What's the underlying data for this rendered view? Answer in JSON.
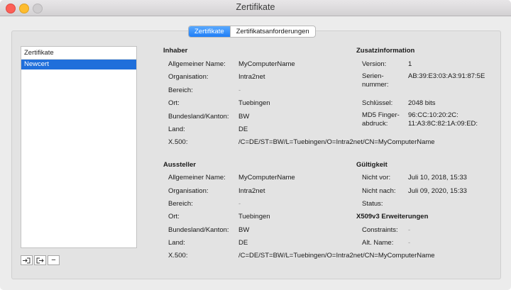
{
  "window": {
    "title": "Zertifikate"
  },
  "tabs": [
    {
      "label": "Zertifikate",
      "active": true
    },
    {
      "label": "Zertifikatsanforderungen",
      "active": false
    }
  ],
  "list": {
    "header": "Zertifikate",
    "items": [
      "Newcert"
    ]
  },
  "inhaber": {
    "heading": "Inhaber",
    "rows": [
      {
        "label": "Allgemeiner Name:",
        "value": "MyComputerName"
      },
      {
        "label": "Organisation:",
        "value": "Intra2net"
      },
      {
        "label": "Bereich:",
        "value": "-"
      },
      {
        "label": "Ort:",
        "value": "Tuebingen"
      },
      {
        "label": "Bundesland/Kanton:",
        "value": "BW"
      },
      {
        "label": "Land:",
        "value": "DE"
      },
      {
        "label": "X.500:",
        "value": "/C=DE/ST=BW/L=Tuebingen/O=Intra2net/CN=MyComputerName"
      }
    ]
  },
  "aussteller": {
    "heading": "Aussteller",
    "rows": [
      {
        "label": "Allgemeiner Name:",
        "value": "MyComputerName"
      },
      {
        "label": "Organisation:",
        "value": "Intra2net"
      },
      {
        "label": "Bereich:",
        "value": "-"
      },
      {
        "label": "Ort:",
        "value": "Tuebingen"
      },
      {
        "label": "Bundesland/Kanton:",
        "value": "BW"
      },
      {
        "label": "Land:",
        "value": "DE"
      },
      {
        "label": "X.500:",
        "value": "/C=DE/ST=BW/L=Tuebingen/O=Intra2net/CN=MyComputerName"
      }
    ]
  },
  "zusatz": {
    "heading": "Zusatzinformation",
    "version_label": "Version:",
    "version": "1",
    "serial_label_1": "Serien-",
    "serial_label_2": "nummer:",
    "serial": "AB:39:E3:03:A3:91:87:5E",
    "key_label": "Schlüssel:",
    "key": "2048 bits",
    "md5_label_1": "MD5 Finger-",
    "md5_label_2": "abdruck:",
    "md5_1": "96:CC:10:20:2C:",
    "md5_2": "11:A3:8C:82:1A:09:ED:"
  },
  "gueltigkeit": {
    "heading": "Gültigkeit",
    "before_label": "Nicht vor:",
    "before": "Juli 10, 2018, 15:33",
    "after_label": "Nicht nach:",
    "after": "Juli 09, 2020, 15:33",
    "status_label": "Status:"
  },
  "x509": {
    "heading": "X509v3 Erweiterungen",
    "constraints_label": "Constraints:",
    "constraints": "-",
    "altname_label": "Alt. Name:",
    "altname": "-"
  },
  "buttons": {
    "import_icon": "import-icon",
    "export_icon": "export-icon",
    "remove_label": "−"
  }
}
